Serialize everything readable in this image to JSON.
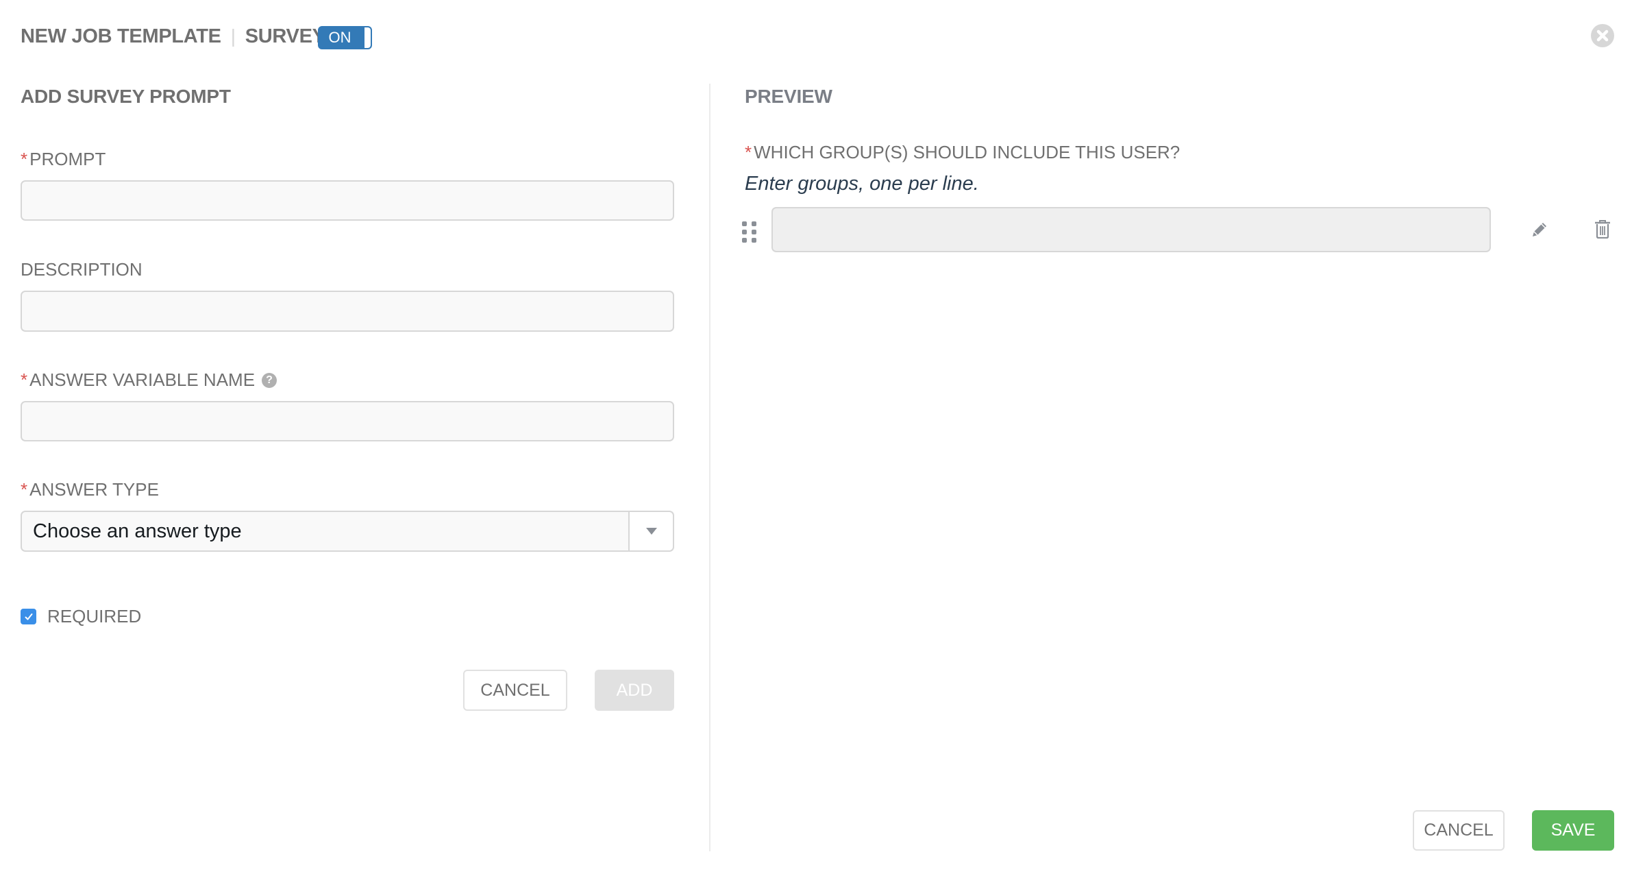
{
  "header": {
    "title": "NEW JOB TEMPLATE",
    "separator": "|",
    "subtitle": "SURVEY",
    "survey_toggle": {
      "label": "ON",
      "state": "on"
    },
    "close_icon": "close-circle-icon"
  },
  "form": {
    "section_title": "ADD SURVEY PROMPT",
    "required_marker": "*",
    "fields": {
      "prompt": {
        "label": "PROMPT",
        "required": true,
        "value": "",
        "placeholder": ""
      },
      "description": {
        "label": "DESCRIPTION",
        "required": false,
        "value": "",
        "placeholder": ""
      },
      "variable_name": {
        "label": "ANSWER VARIABLE NAME",
        "required": true,
        "value": "",
        "placeholder": "",
        "help_icon": "question-circle-icon"
      },
      "answer_type": {
        "label": "ANSWER TYPE",
        "required": true,
        "selected": "Choose an answer type"
      }
    },
    "required_checkbox": {
      "label": "REQUIRED",
      "checked": true
    },
    "cancel_label": "CANCEL",
    "add_label": "ADD"
  },
  "preview": {
    "title": "PREVIEW",
    "question": {
      "label": "WHICH GROUP(S) SHOULD INCLUDE THIS USER?",
      "required": true,
      "hint": "Enter groups, one per line.",
      "value": ""
    },
    "edit_icon": "pencil-icon",
    "delete_icon": "trash-icon",
    "drag_icon": "drag-handle-icon"
  },
  "footer": {
    "cancel_label": "CANCEL",
    "save_label": "SAVE"
  },
  "colors": {
    "accent": "#337ab7",
    "required": "#d9534f",
    "success": "#5cb85c",
    "checkbox": "#3a8fe8",
    "text": "#707070"
  }
}
